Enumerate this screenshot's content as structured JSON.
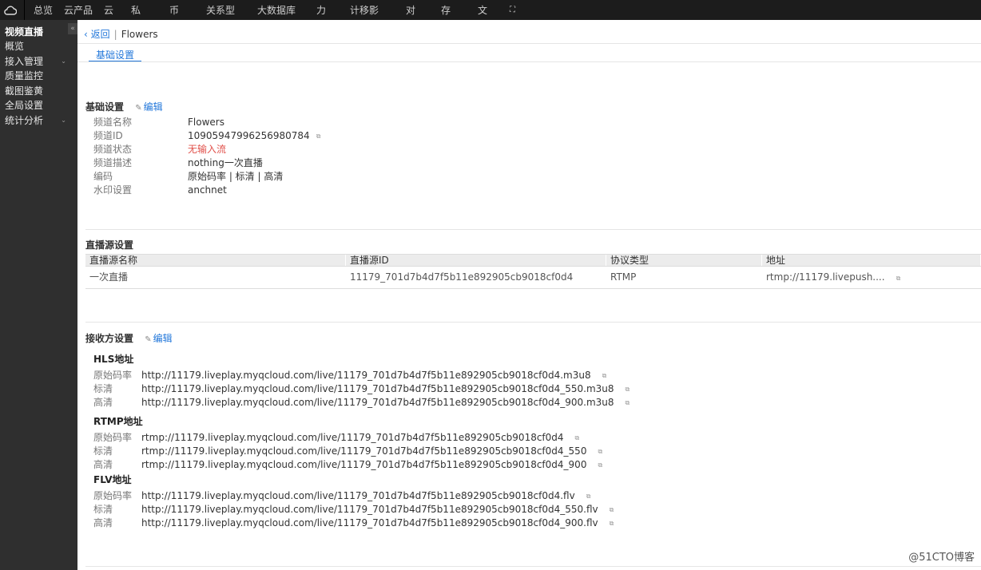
{
  "topbar": {
    "nav": [
      "总览",
      "云产品",
      "云",
      "私",
      "币",
      "关系型",
      "大数据库",
      "力",
      "计移影",
      "对",
      "存",
      "文"
    ]
  },
  "sidebar": {
    "title": "视频直播",
    "collapse": "«",
    "items": [
      {
        "label": "概览",
        "chevron": false
      },
      {
        "label": "接入管理",
        "chevron": true
      },
      {
        "label": "质量监控",
        "chevron": false
      },
      {
        "label": "截图鉴黄",
        "chevron": false
      },
      {
        "label": "全局设置",
        "chevron": false
      },
      {
        "label": "统计分析",
        "chevron": true
      }
    ]
  },
  "breadcrumb": {
    "back": "返回",
    "name": "Flowers"
  },
  "tab": "基础设置",
  "basic": {
    "title": "基础设置",
    "edit": "编辑",
    "rows": [
      {
        "k": "频道名称",
        "v": "Flowers"
      },
      {
        "k": "频道ID",
        "v": "10905947996256980784"
      },
      {
        "k": "频道状态",
        "v": "无输入流"
      },
      {
        "k": "频道描述",
        "v": "nothing一次直播"
      },
      {
        "k": "编码",
        "v": "原始码率 | 标清 | 高清"
      },
      {
        "k": "水印设置",
        "v": "anchnet"
      }
    ]
  },
  "source": {
    "title": "直播源设置",
    "headers": [
      "直播源名称",
      "直播源ID",
      "协议类型",
      "地址"
    ],
    "row": [
      "一次直播",
      "11179_701d7b4d7f5b11e892905cb9018cf0d4",
      "RTMP",
      "rtmp://11179.livepush...."
    ]
  },
  "receiver": {
    "title": "接收方设置",
    "edit": "编辑",
    "groups": [
      {
        "title": "HLS地址",
        "rows": [
          {
            "k": "原始码率",
            "v": "http://11179.liveplay.myqcloud.com/live/11179_701d7b4d7f5b11e892905cb9018cf0d4.m3u8"
          },
          {
            "k": "标清",
            "v": "http://11179.liveplay.myqcloud.com/live/11179_701d7b4d7f5b11e892905cb9018cf0d4_550.m3u8"
          },
          {
            "k": "高清",
            "v": "http://11179.liveplay.myqcloud.com/live/11179_701d7b4d7f5b11e892905cb9018cf0d4_900.m3u8"
          }
        ]
      },
      {
        "title": "RTMP地址",
        "rows": [
          {
            "k": "原始码率",
            "v": "rtmp://11179.liveplay.myqcloud.com/live/11179_701d7b4d7f5b11e892905cb9018cf0d4"
          },
          {
            "k": "标清",
            "v": "rtmp://11179.liveplay.myqcloud.com/live/11179_701d7b4d7f5b11e892905cb9018cf0d4_550"
          },
          {
            "k": "高清",
            "v": "rtmp://11179.liveplay.myqcloud.com/live/11179_701d7b4d7f5b11e892905cb9018cf0d4_900"
          }
        ]
      },
      {
        "title": "FLV地址",
        "rows": [
          {
            "k": "原始码率",
            "v": "http://11179.liveplay.myqcloud.com/live/11179_701d7b4d7f5b11e892905cb9018cf0d4.flv"
          },
          {
            "k": "标清",
            "v": "http://11179.liveplay.myqcloud.com/live/11179_701d7b4d7f5b11e892905cb9018cf0d4_550.flv"
          },
          {
            "k": "高清",
            "v": "http://11179.liveplay.myqcloud.com/live/11179_701d7b4d7f5b11e892905cb9018cf0d4_900.flv"
          }
        ]
      }
    ]
  },
  "watermark": "@51CTO博客",
  "colors": {
    "accent": "#2277da",
    "alert": "#e1504a",
    "sidebar": "#2f2f2f",
    "topbar": "#1c1c1c"
  }
}
